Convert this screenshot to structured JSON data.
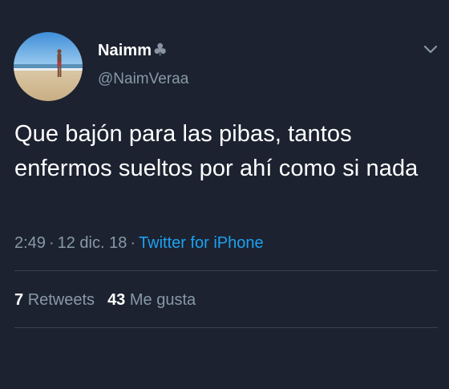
{
  "tweet": {
    "user": {
      "display_name": "Naimm",
      "name_emoji_icon": "club-suit-icon",
      "name_emoji_glyph": "♣",
      "handle": "@NaimVeraa",
      "avatar_icon": "beach-photo-avatar"
    },
    "menu_icon": "chevron-down-icon",
    "text": "Que bajón para las pibas, tantos enfermos sueltos por ahí como si nada",
    "time": "2:49",
    "date": "12 dic. 18",
    "separator": "·",
    "source": "Twitter for iPhone",
    "stats": {
      "retweets_count": "7",
      "retweets_label": "Retweets",
      "likes_count": "43",
      "likes_label": "Me gusta"
    }
  },
  "colors": {
    "background": "#1c2230",
    "primary_text": "#ffffff",
    "secondary_text": "#8899a6",
    "link": "#1da1f2",
    "divider": "#38444d"
  }
}
